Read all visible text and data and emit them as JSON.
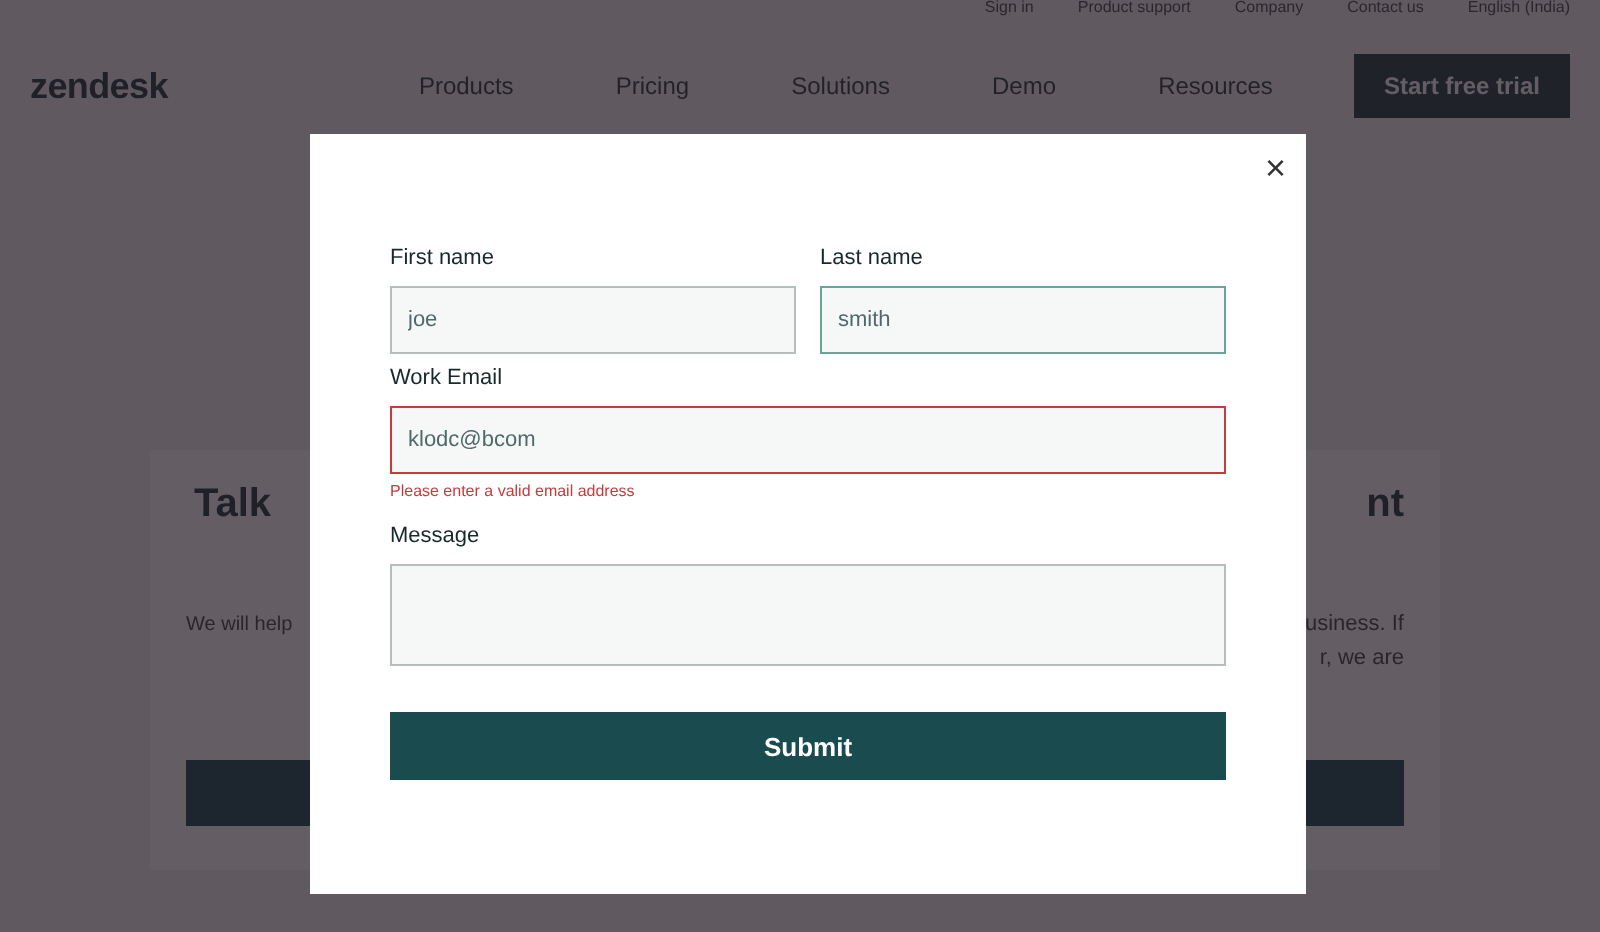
{
  "utility_links": [
    "Sign in",
    "Product support",
    "Company",
    "Contact us",
    "English (India)"
  ],
  "logo": "zendesk",
  "nav": [
    "Products",
    "Pricing",
    "Solutions",
    "Demo",
    "Resources"
  ],
  "cta": "Start free trial",
  "background_card": {
    "left_heading": "Talk",
    "right_heading": "nt",
    "left_text": [
      "We will help"
    ],
    "right_text": [
      "usiness. If",
      "r, we are"
    ]
  },
  "modal": {
    "close": "×",
    "fields": [
      {
        "label": "First name",
        "value": "joe",
        "kind": "input",
        "focused": false,
        "error": false
      },
      {
        "label": "Last name",
        "value": "smith",
        "kind": "input",
        "focused": true,
        "error": false
      },
      {
        "label": "Work Email",
        "value": "klodc@bcom",
        "kind": "input",
        "focused": false,
        "error": true,
        "error_text": "Please enter a valid email address"
      },
      {
        "label": "Message",
        "kind": "textarea",
        "focused": false,
        "error": false
      }
    ],
    "submit": "Submit"
  }
}
